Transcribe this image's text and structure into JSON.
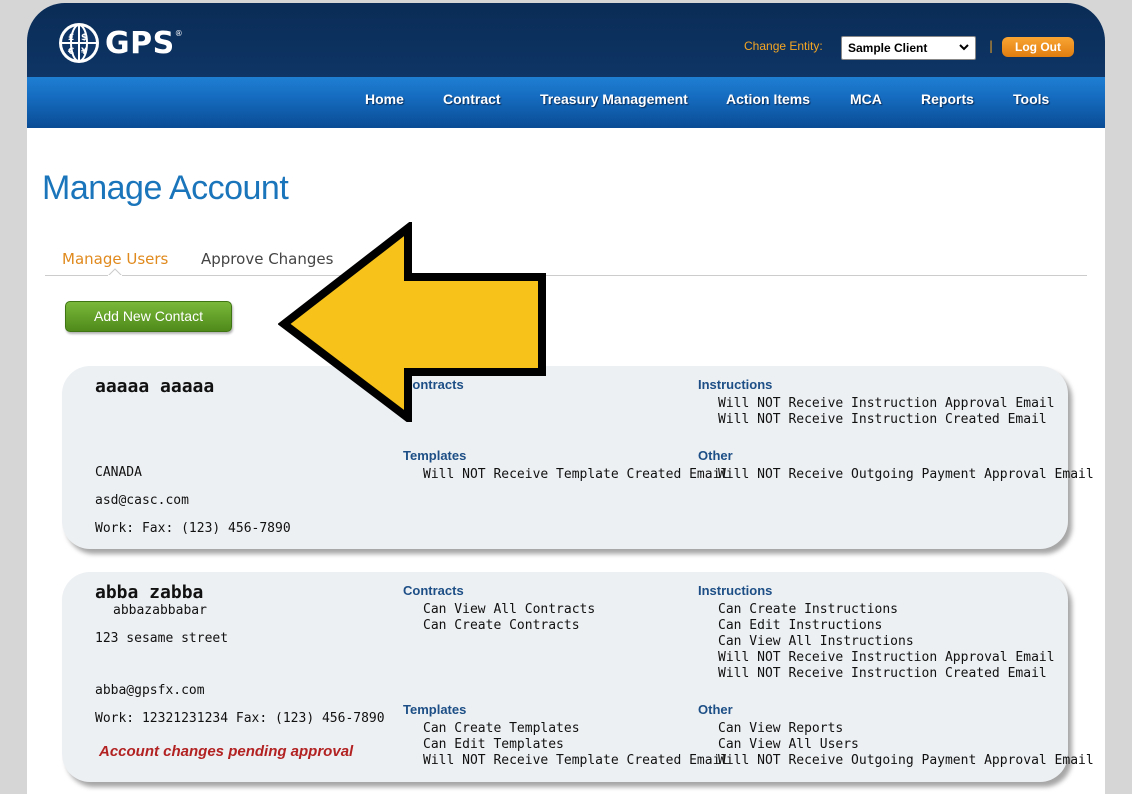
{
  "header": {
    "logo_text": "GPS",
    "logo_reg": "®",
    "change_entity_label": "Change Entity:",
    "entity_selected": "Sample Client",
    "separator": "|",
    "logout_label": "Log Out"
  },
  "nav": {
    "items": [
      "Home",
      "Contract",
      "Treasury Management",
      "Action Items",
      "MCA",
      "Reports",
      "Tools"
    ]
  },
  "page": {
    "title": "Manage Account",
    "tabs": [
      "Manage Users",
      "Approve Changes"
    ],
    "add_button": "Add New Contact"
  },
  "contacts": [
    {
      "name": "aaaaa  aaaaa",
      "country": "CANADA",
      "email": "asd@casc.com",
      "phone": "Work:   Fax: (123) 456-7890",
      "contracts_title": "Contracts",
      "templates_title": "Templates",
      "templates": [
        "Will NOT Receive Template Created Email"
      ],
      "instructions_title": "Instructions",
      "instructions": [
        "Will NOT Receive Instruction Approval Email",
        "Will NOT Receive Instruction Created Email"
      ],
      "other_title": "Other",
      "other": [
        "Will NOT Receive Outgoing Payment Approval Email"
      ]
    },
    {
      "name": "abba  zabba",
      "username": "abbazabbabar",
      "address": "123 sesame street",
      "email": "abba@gpsfx.com",
      "phone": "Work: 12321231234  Fax: (123) 456-7890",
      "pending": "Account changes pending approval",
      "contracts_title": "Contracts",
      "contracts": [
        "Can View All Contracts",
        "Can Create Contracts"
      ],
      "templates_title": "Templates",
      "templates": [
        "Can Create Templates",
        "Can Edit Templates",
        "Will NOT Receive Template Created Email"
      ],
      "instructions_title": "Instructions",
      "instructions": [
        "Can Create Instructions",
        "Can Edit Instructions",
        "Can View All Instructions",
        "Will NOT Receive Instruction Approval Email",
        "Will NOT Receive Instruction Created Email"
      ],
      "other_title": "Other",
      "other": [
        "Can View Reports",
        "Can View All Users",
        "Will NOT Receive Outgoing Payment Approval Email"
      ]
    }
  ],
  "colors": {
    "header_dark": "#0e3566",
    "nav_blue": "#156bbf",
    "accent_orange": "#e08a1e",
    "title_blue": "#1a75bb",
    "pending_red": "#b22222",
    "arrow_yellow": "#f7c31a"
  }
}
